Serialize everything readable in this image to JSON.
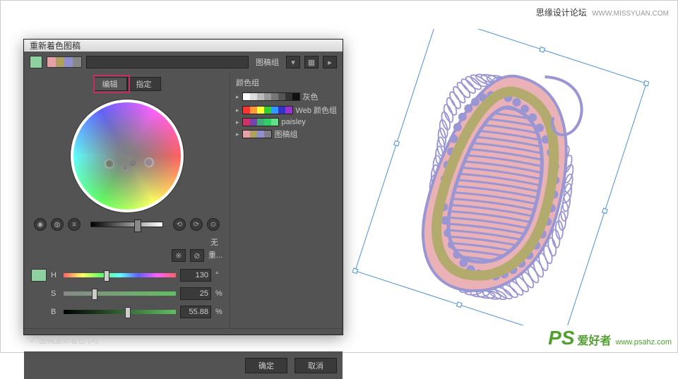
{
  "watermark_top": {
    "text": "思缘设计论坛",
    "url": "WWW.MISSYUAN.COM"
  },
  "watermark_bottom": {
    "ps": "PS",
    "zh": "爱好者",
    "url": "www.psahz.com"
  },
  "dialog": {
    "title": "重新着色图稿",
    "preset_label": "图稿组",
    "tabs": {
      "edit": "编辑",
      "assign": "指定"
    },
    "no_label": "无",
    "reset_label": "重...",
    "hsb": {
      "h_label": "H",
      "h_value": "130",
      "h_unit": "°",
      "s_label": "S",
      "s_value": "25",
      "s_unit": "%",
      "b_label": "B",
      "b_value": "55.88",
      "b_unit": "%"
    },
    "checkbox_label": "图稿重新着色 (A)",
    "ok": "确定",
    "cancel": "取消"
  },
  "color_groups": {
    "header": "颜色组",
    "rows": [
      {
        "name": "灰色",
        "colors": [
          "#ffffff",
          "#dddddd",
          "#bbbbbb",
          "#999999",
          "#777777",
          "#555555",
          "#333333",
          "#111111"
        ]
      },
      {
        "name": "Web 颜色组",
        "colors": [
          "#ff3333",
          "#ff9933",
          "#ffff33",
          "#33cc33",
          "#3399ff",
          "#3333cc",
          "#9933cc"
        ]
      },
      {
        "name": "paisley",
        "colors": [
          "#cc3366",
          "#7744aa",
          "#44aa77",
          "#33cc66",
          "#66dd88"
        ]
      },
      {
        "name": "图稿组",
        "colors": [
          "#e8a0a8",
          "#b0a060",
          "#9090d0",
          "#808080"
        ]
      }
    ]
  },
  "toolbar_swatches": [
    "#e8a0a8",
    "#b0a060",
    "#9090d0",
    "#888888"
  ]
}
